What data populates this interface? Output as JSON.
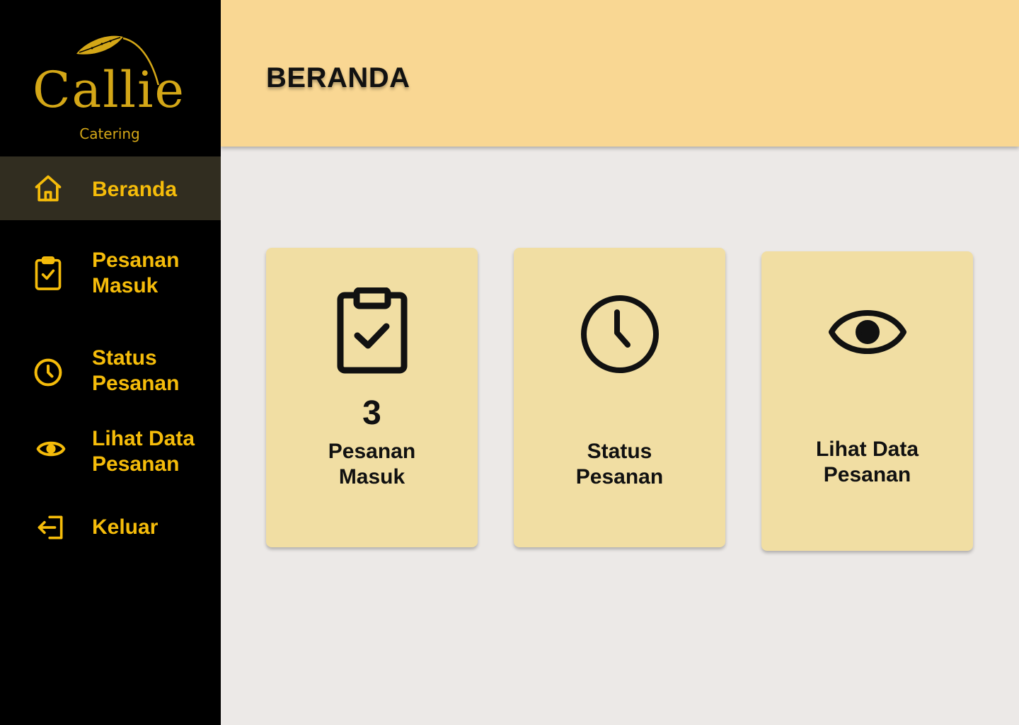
{
  "brand": {
    "name": "Callie",
    "tagline": "Catering",
    "accent_color": "#D4A717"
  },
  "sidebar": {
    "items": [
      {
        "label": "Beranda",
        "icon": "home-icon",
        "active": true
      },
      {
        "label": "Pesanan\nMasuk",
        "icon": "clipboard-check-icon",
        "active": false
      },
      {
        "label": "Status\nPesanan",
        "icon": "clock-icon",
        "active": false
      },
      {
        "label": "Lihat Data\nPesanan",
        "icon": "eye-icon",
        "active": false
      },
      {
        "label": "Keluar",
        "icon": "logout-icon",
        "active": false
      }
    ]
  },
  "header": {
    "title": "BERANDA"
  },
  "cards": [
    {
      "icon": "clipboard-check-icon",
      "count": "3",
      "label": "Pesanan\nMasuk"
    },
    {
      "icon": "clock-icon",
      "label": "Status\nPesanan"
    },
    {
      "icon": "eye-icon",
      "label": "Lihat Data\nPesanan"
    }
  ],
  "colors": {
    "sidebar_bg": "#000000",
    "sidebar_active_bg": "#312D20",
    "sidebar_text": "#F5BC0A",
    "header_bg": "#F9D793",
    "card_bg": "#F1DEA3",
    "page_bg": "#ECE9E7"
  }
}
